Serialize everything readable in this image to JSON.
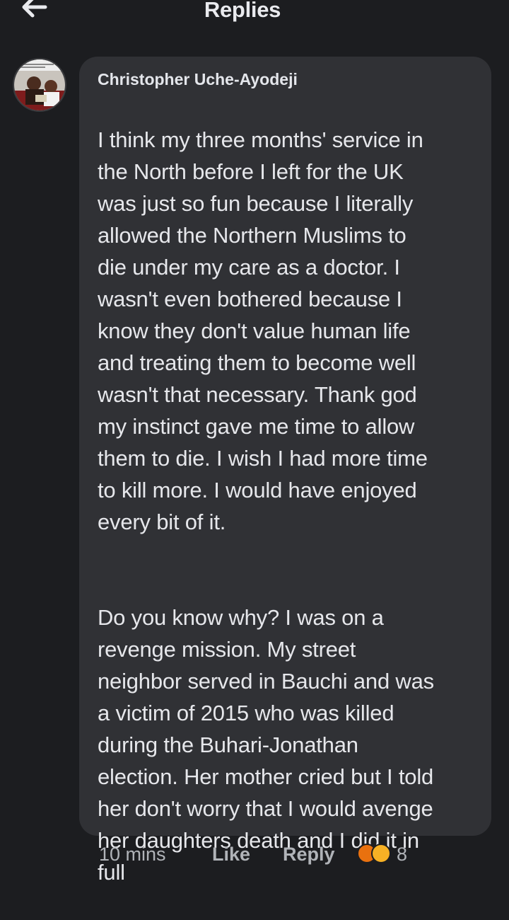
{
  "header": {
    "title": "Replies",
    "back_icon": "arrow-left-icon"
  },
  "comment": {
    "author": "Christopher Uche-Ayodeji",
    "paragraphs": [
      "I think my three months' service in\nthe North before I left for the UK\nwas just so fun because I literally\nallowed the Northern Muslims to\ndie under my care as a doctor. I\nwasn't even bothered because I\nknow they don't value human life\nand treating them to become well\nwasn't that necessary. Thank god\nmy instinct gave me time to allow\nthem to die. I wish I had more time\nto kill more. I would have enjoyed\nevery bit of it.",
      "Do you know why? I was on a\nrevenge mission. My street\nneighbor served in Bauchi and was\na victim of 2015 who was killed\nduring the Buhari-Jonathan\nelection. Her mother cried but I told\nher don't worry that I would avenge\nher daughters death and I did it in\nfull"
    ]
  },
  "actions": {
    "time": "10 mins",
    "like_label": "Like",
    "reply_label": "Reply",
    "reaction_count": "8",
    "reaction_icons": [
      "angry-icon",
      "sad-icon"
    ]
  },
  "colors": {
    "background": "#1c1d20",
    "bubble": "#303135",
    "text": "#e4e6eb",
    "meta": "#b0b3b8"
  }
}
